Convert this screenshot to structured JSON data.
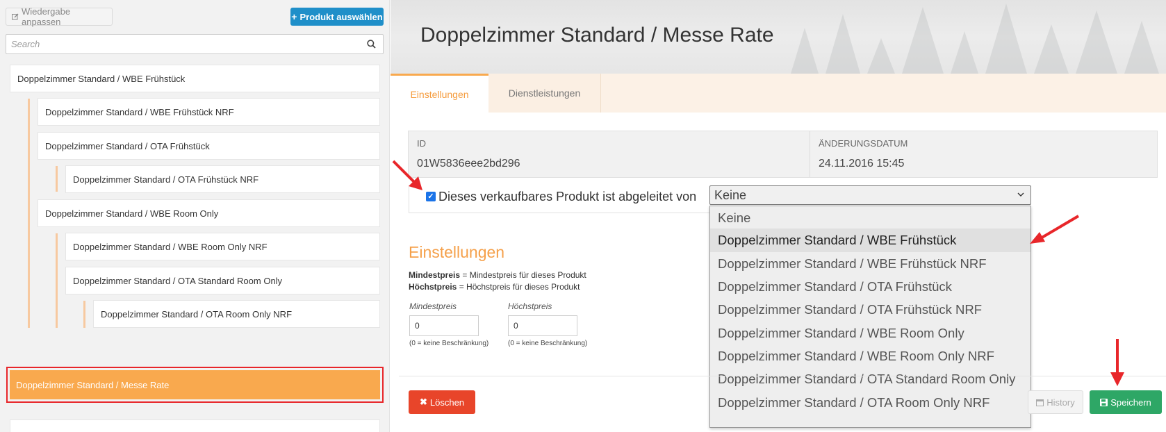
{
  "sidebar": {
    "adjust_label": "Wiedergabe anpassen",
    "select_product_label": "Produkt auswählen",
    "search_placeholder": "Search",
    "items": [
      {
        "label": "Doppelzimmer Standard / WBE Frühstück"
      },
      {
        "label": "Doppelzimmer Standard / WBE Frühstück NRF"
      },
      {
        "label": "Doppelzimmer Standard / OTA Frühstück"
      },
      {
        "label": "Doppelzimmer Standard / OTA Frühstück NRF"
      },
      {
        "label": "Doppelzimmer Standard / WBE Room Only"
      },
      {
        "label": "Doppelzimmer Standard / WBE Room Only NRF"
      },
      {
        "label": "Doppelzimmer Standard / OTA Standard Room Only"
      },
      {
        "label": "Doppelzimmer Standard / OTA Room Only NRF"
      },
      {
        "label": "Doppelzimmer Standard / Messe Rate"
      }
    ]
  },
  "header": {
    "title": "Doppelzimmer Standard / Messe Rate"
  },
  "tabs": [
    {
      "label": "Einstellungen"
    },
    {
      "label": "Dienstleistungen"
    }
  ],
  "info": {
    "id_label": "ID",
    "id_value": "01W5836eee2bd296",
    "date_label": "ÄNDERUNGSDATUM",
    "date_value": "24.11.2016 15:45"
  },
  "derived": {
    "label": "Dieses verkaufbares Produkt ist abgeleitet von",
    "checked": true,
    "selected_value": "Keine",
    "options": [
      "Keine",
      "Doppelzimmer Standard / WBE Frühstück",
      "Doppelzimmer Standard / WBE Frühstück NRF",
      "Doppelzimmer Standard / OTA Frühstück",
      "Doppelzimmer Standard / OTA Frühstück NRF",
      "Doppelzimmer Standard / WBE Room Only",
      "Doppelzimmer Standard / WBE Room Only NRF",
      "Doppelzimmer Standard / OTA Standard Room Only",
      "Doppelzimmer Standard / OTA Room Only NRF"
    ],
    "highlighted_option": "Doppelzimmer Standard / WBE Frühstück"
  },
  "settings": {
    "title": "Einstellungen",
    "min_term": "Mindestpreis",
    "min_desc": " = Mindestpreis für dieses Produkt",
    "max_term": "Höchstpreis",
    "max_desc": " = Höchstpreis für dieses Produkt",
    "min_label": "Mindestpreis",
    "min_value": "0",
    "min_hint": "(0 = keine Beschränkung)",
    "max_label": "Höchstpreis",
    "max_value": "0",
    "max_hint": "(0 = keine Beschränkung)"
  },
  "actions": {
    "delete_label": "Löschen",
    "history_label": "History",
    "save_label": "Speichern"
  },
  "colors": {
    "accent": "#f9a94e",
    "primary_blue": "#1f8fc9",
    "delete_red": "#e8452a",
    "save_green": "#2ea766",
    "annotation_red": "#e8262a"
  },
  "icons": {
    "adjust": "edit-square-icon",
    "select_product": "plus-icon",
    "search": "search-icon",
    "select_chevron": "chevron-down-icon",
    "delete": "close-icon",
    "history": "calendar-icon",
    "save": "floppy-disk-icon"
  }
}
